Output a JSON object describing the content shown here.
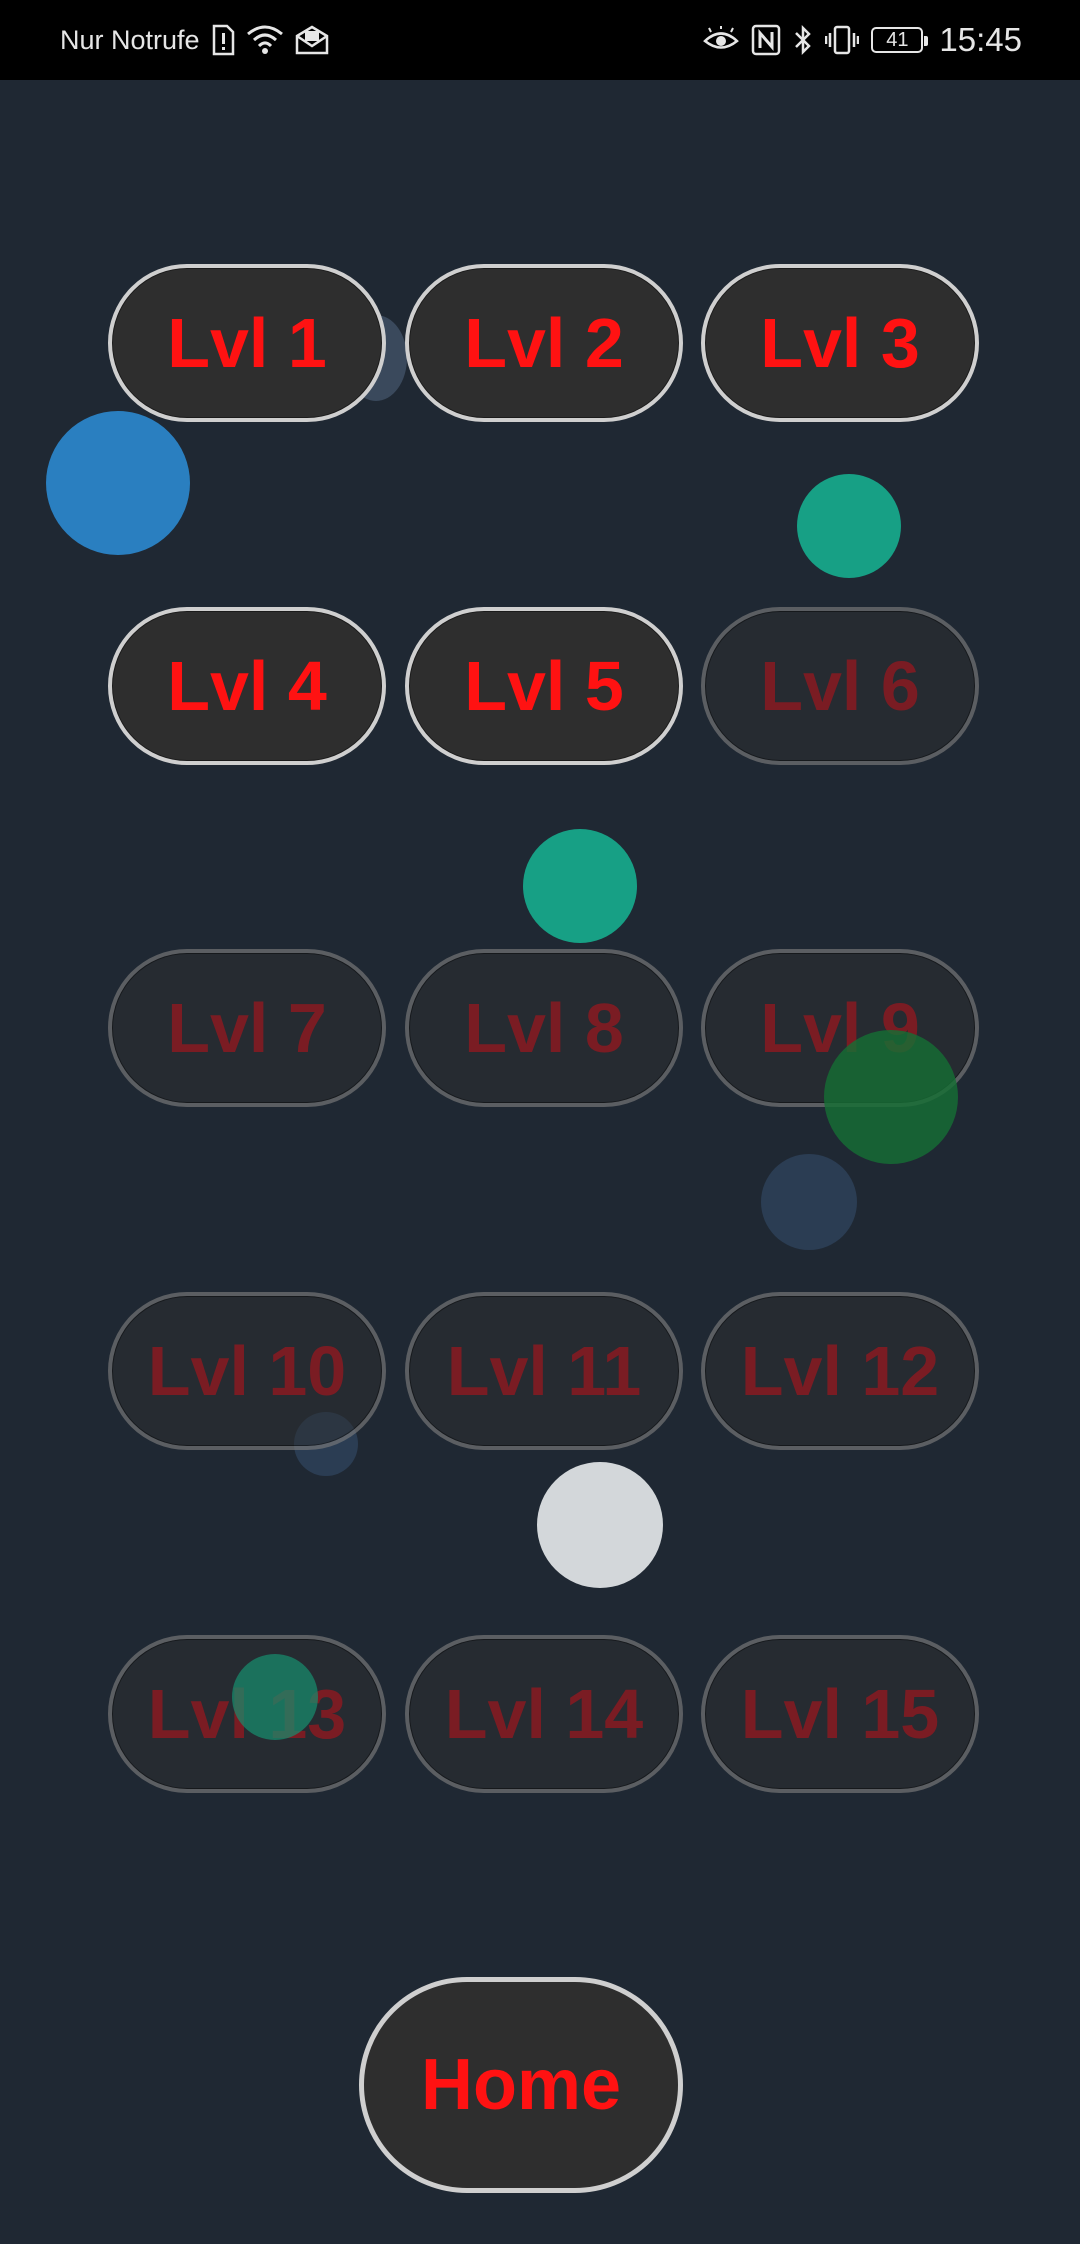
{
  "status_bar": {
    "carrier": "Nur Notrufe",
    "battery": "41",
    "time": "15:45",
    "left_icons": [
      "sim-alert-icon",
      "wifi-icon",
      "mail-icon"
    ],
    "right_icons": [
      "eye-icon",
      "nfc-icon",
      "bluetooth-icon",
      "vibrate-icon",
      "battery-icon"
    ]
  },
  "levels": [
    {
      "label": "Lvl 1",
      "unlocked": true
    },
    {
      "label": "Lvl 2",
      "unlocked": true
    },
    {
      "label": "Lvl 3",
      "unlocked": true
    },
    {
      "label": "Lvl 4",
      "unlocked": true
    },
    {
      "label": "Lvl 5",
      "unlocked": true
    },
    {
      "label": "Lvl 6",
      "unlocked": false
    },
    {
      "label": "Lvl 7",
      "unlocked": false
    },
    {
      "label": "Lvl 8",
      "unlocked": false
    },
    {
      "label": "Lvl 9",
      "unlocked": false
    },
    {
      "label": "Lvl 10",
      "unlocked": false
    },
    {
      "label": "Lvl 11",
      "unlocked": false
    },
    {
      "label": "Lvl 12",
      "unlocked": false
    },
    {
      "label": "Lvl 13",
      "unlocked": false
    },
    {
      "label": "Lvl 14",
      "unlocked": false
    },
    {
      "label": "Lvl 15",
      "unlocked": false
    }
  ],
  "home_label": "Home",
  "colors": {
    "background": "#1f2833",
    "button_fill": "#2e2e2e",
    "button_text": "#ff1212",
    "button_border": "#cfcfcf"
  }
}
